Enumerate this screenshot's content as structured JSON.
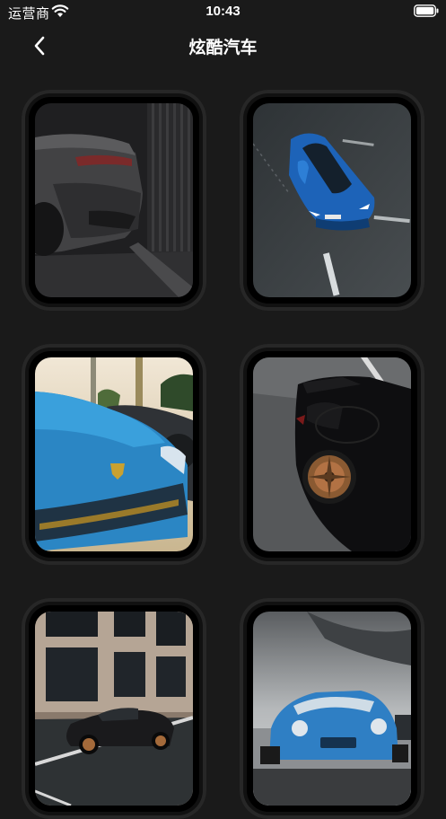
{
  "status_bar": {
    "carrier": "运营商",
    "time": "10:43"
  },
  "nav": {
    "title": "炫酷汽车",
    "back_icon": "chevron-left-icon"
  },
  "gallery": {
    "items": [
      {
        "name": "car-photo-dark-sportscar-rear"
      },
      {
        "name": "car-photo-blue-coupe-road"
      },
      {
        "name": "car-photo-blue-lamborghini-hood"
      },
      {
        "name": "car-photo-black-porsche-bronze-wheels"
      },
      {
        "name": "car-photo-black-porsche-street"
      },
      {
        "name": "car-photo-blue-porsche-track"
      }
    ]
  },
  "colors": {
    "background": "#1a1a1a",
    "card_frame": "#111111",
    "card_ring": "#272727"
  }
}
